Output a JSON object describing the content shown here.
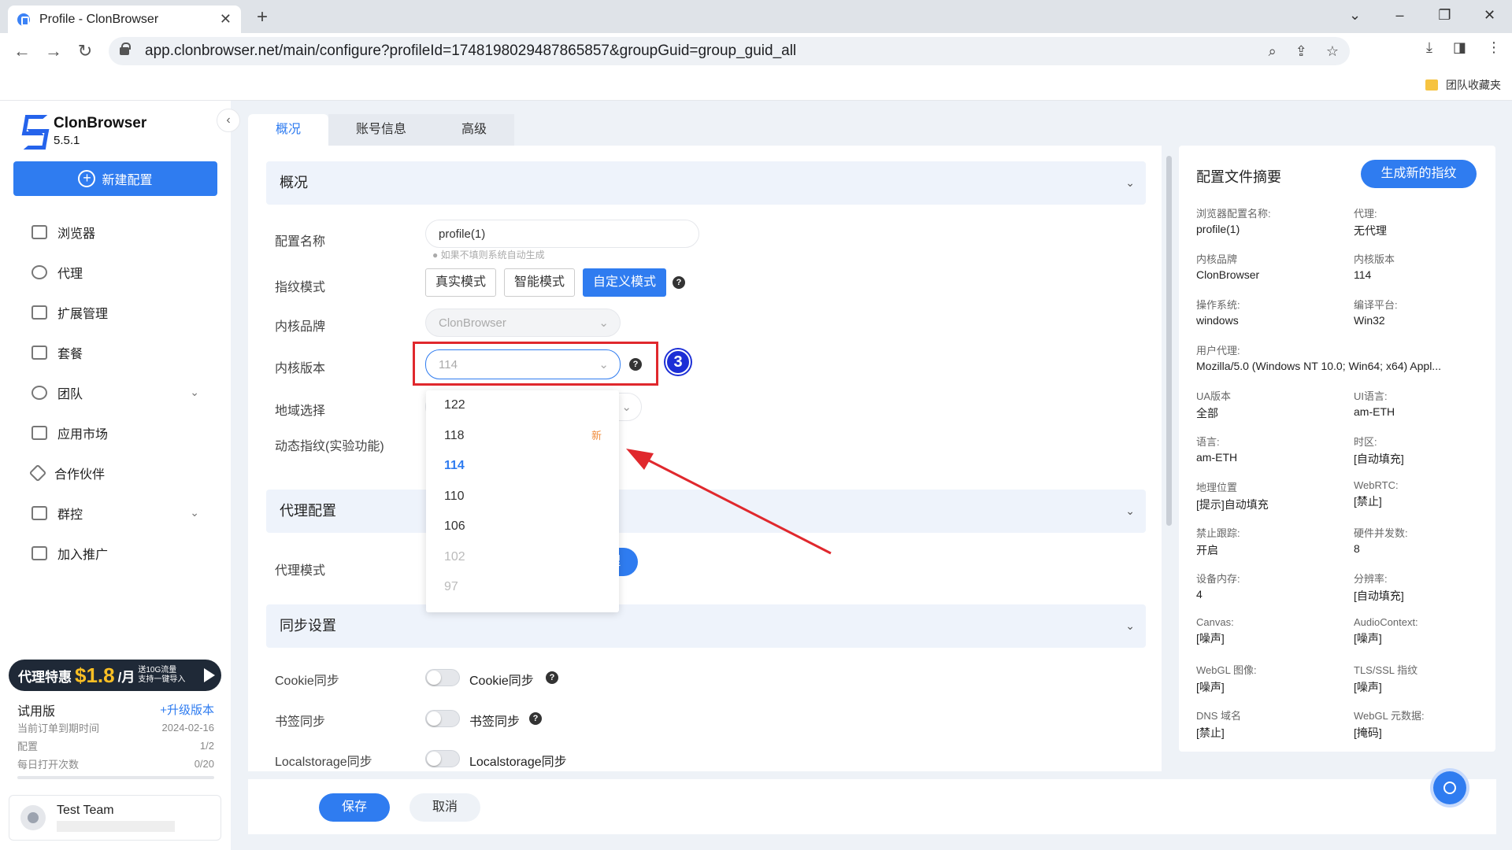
{
  "browser": {
    "tab_title": "Profile - ClonBrowser",
    "url": "app.clonbrowser.net/main/configure?profileId=1748198029487865857&groupGuid=group_guid_all",
    "bookmark": "团队收藏夹"
  },
  "app": {
    "name": "ClonBrowser",
    "version": "5.5.1",
    "new_config": "新建配置"
  },
  "menu": [
    "浏览器",
    "代理",
    "扩展管理",
    "套餐",
    "团队",
    "应用市场",
    "合作伙伴",
    "群控",
    "加入推广"
  ],
  "promo": {
    "left": "代理特惠",
    "price": "$1.8",
    "unit": "/月",
    "line1": "送10G流量",
    "line2": "支持一键导入"
  },
  "plan": {
    "name": "试用版",
    "upgrade": "+升级版本",
    "rows": [
      {
        "k": "当前订单到期时间",
        "v": "2024-02-16"
      },
      {
        "k": "配置",
        "v": "1/2"
      },
      {
        "k": "每日打开次数",
        "v": "0/20"
      }
    ]
  },
  "user": {
    "name": "Test Team"
  },
  "tabs": [
    "概况",
    "账号信息",
    "高级"
  ],
  "sections": {
    "overview": "概况",
    "proxy": "代理配置",
    "sync": "同步设置"
  },
  "form": {
    "name_label": "配置名称",
    "name_value": "profile(1)",
    "name_hint": "如果不填则系统自动生成",
    "fp_label": "指纹模式",
    "fp_modes": [
      "真实模式",
      "智能模式",
      "自定义模式"
    ],
    "brand_label": "内核品牌",
    "brand_value": "ClonBrowser",
    "version_label": "内核版本",
    "version_value": "114",
    "region_label": "地域选择",
    "dynamic_label": "动态指纹(实验功能)",
    "proxy_mode_label": "代理模式",
    "proxy_btn_fragment": "理",
    "cookie_label": "Cookie同步",
    "cookie_toggle": "Cookie同步",
    "bookmark_label": "书签同步",
    "bookmark_toggle": "书签同步",
    "ls_label": "Localstorage同步",
    "ls_toggle": "Localstorage同步"
  },
  "step_number": "3",
  "dropdown": [
    {
      "v": "122",
      "badge": ""
    },
    {
      "v": "118",
      "badge": "新"
    },
    {
      "v": "114",
      "badge": ""
    },
    {
      "v": "110",
      "badge": ""
    },
    {
      "v": "106",
      "badge": ""
    },
    {
      "v": "102",
      "badge": ""
    },
    {
      "v": "97",
      "badge": ""
    }
  ],
  "summary": {
    "title": "配置文件摘要",
    "generate": "生成新的指纹",
    "items": [
      {
        "k": "浏览器配置名称:",
        "v": "profile(1)"
      },
      {
        "k": "代理:",
        "v": "无代理"
      },
      {
        "k": "内核品牌",
        "v": "ClonBrowser"
      },
      {
        "k": "内核版本",
        "v": "114"
      },
      {
        "k": "操作系统:",
        "v": "windows"
      },
      {
        "k": "编译平台:",
        "v": "Win32"
      },
      {
        "k": "用户代理:",
        "v": "Mozilla/5.0 (Windows NT 10.0; Win64; x64) Appl..."
      },
      {
        "k": "UA版本",
        "v": "全部"
      },
      {
        "k": "UI语言:",
        "v": "am-ETH"
      },
      {
        "k": "语言:",
        "v": "am-ETH"
      },
      {
        "k": "时区:",
        "v": "[自动填充]"
      },
      {
        "k": "地理位置",
        "v": "[提示]自动填充"
      },
      {
        "k": "WebRTC:",
        "v": "[禁止]"
      },
      {
        "k": "禁止跟踪:",
        "v": "开启"
      },
      {
        "k": "硬件并发数:",
        "v": "8"
      },
      {
        "k": "设备内存:",
        "v": "4"
      },
      {
        "k": "分辨率:",
        "v": "[自动填充]"
      },
      {
        "k": "Canvas:",
        "v": "[噪声]"
      },
      {
        "k": "AudioContext:",
        "v": "[噪声]"
      },
      {
        "k": "WebGL 图像:",
        "v": "[噪声]"
      },
      {
        "k": "TLS/SSL 指纹",
        "v": "[噪声]"
      },
      {
        "k": "DNS 域名",
        "v": "[禁止]"
      },
      {
        "k": "WebGL 元数据:",
        "v": "[掩码]"
      }
    ]
  },
  "footer": {
    "save": "保存",
    "cancel": "取消"
  },
  "colors": {
    "primary": "#2f7cf0",
    "highlight": "#e0282d",
    "step": "#1d2fd6"
  }
}
